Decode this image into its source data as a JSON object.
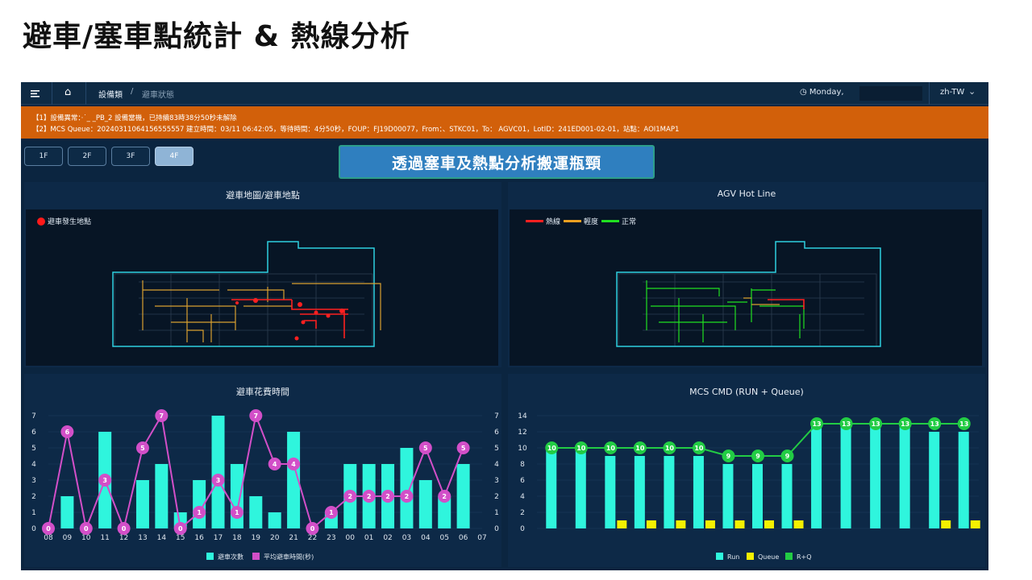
{
  "slide_title": "避車/塞車點統計 & 熱線分析",
  "topbar": {
    "breadcrumb_1": "設備類",
    "breadcrumb_sep": "/",
    "breadcrumb_2": "避車狀態",
    "clock": "Monday,",
    "language": "zh-TW"
  },
  "alerts": [
    "【1】設備異常：·˙_ _PB_2  設備當機，已持續83時38分50秒未解除",
    "【2】MCS Queue：20240311064156555557  建立時間：03/11 06:42:05，等待時間：4分50秒，FOUP：FJ19D00077，From：、STKC01，To：  AGVC01，LotID：241ED001-02-01，站點：AOI1MAP1"
  ],
  "floors": [
    "1F",
    "2F",
    "3F",
    "4F"
  ],
  "active_floor": "4F",
  "banner": "透過塞車及熱點分析搬運瓶頸",
  "map_panel": {
    "title": "避車地圖/避車地點",
    "legend": "避車發生地點"
  },
  "hotline_panel": {
    "title": "AGV Hot Line",
    "legend": [
      {
        "label": "熱線",
        "color": "#ff2020"
      },
      {
        "label": "輕度",
        "color": "#f0a020"
      },
      {
        "label": "正常",
        "color": "#20e020"
      }
    ]
  },
  "colors": {
    "accent": "#2f7fbf",
    "alert": "#d2600a",
    "bar_cyan": "#2ff5dd",
    "line_magenta": "#d24fc8",
    "queue_yellow": "#f5f000",
    "rq_green": "#22cc44"
  },
  "chart_data": [
    {
      "type": "bar",
      "title": "避車花費時間",
      "categories": [
        "08",
        "09",
        "10",
        "11",
        "12",
        "13",
        "14",
        "15",
        "16",
        "17",
        "18",
        "19",
        "20",
        "21",
        "22",
        "23",
        "00",
        "01",
        "02",
        "03",
        "04",
        "05",
        "06",
        "07"
      ],
      "ylim": [
        0,
        7
      ],
      "yticks": [
        0,
        1,
        2,
        3,
        4,
        5,
        6,
        7
      ],
      "series": [
        {
          "name": "避車次數",
          "kind": "bar",
          "values": [
            0,
            2,
            0,
            6,
            0,
            3,
            4,
            1,
            3,
            7,
            4,
            2,
            1,
            6,
            0,
            1,
            4,
            4,
            4,
            5,
            3,
            2,
            4,
            null
          ]
        },
        {
          "name": "平均避車時間(秒)",
          "kind": "line",
          "values": [
            0,
            6,
            0,
            3,
            0,
            5,
            7,
            0,
            1,
            3,
            1,
            7,
            4,
            4,
            0,
            1,
            2,
            2,
            2,
            2,
            5,
            2,
            5,
            null
          ]
        }
      ]
    },
    {
      "type": "bar",
      "title": "MCS CMD (RUN + Queue)",
      "categories": [
        "",
        "",
        "",
        "",
        "",
        "",
        "",
        "",
        "",
        "",
        "",
        "",
        "",
        "",
        ""
      ],
      "ylim": [
        0,
        14
      ],
      "yticks": [
        0,
        2,
        4,
        6,
        8,
        10,
        12,
        14
      ],
      "series": [
        {
          "name": "Run",
          "kind": "bar",
          "values": [
            10,
            10,
            9,
            9,
            9,
            9,
            8,
            8,
            8,
            13,
            13,
            13,
            13,
            12,
            12
          ]
        },
        {
          "name": "Queue",
          "kind": "bar",
          "values": [
            0,
            0,
            1,
            1,
            1,
            1,
            1,
            1,
            1,
            0,
            0,
            0,
            0,
            1,
            1
          ]
        },
        {
          "name": "R+Q",
          "kind": "line",
          "values": [
            10,
            10,
            10,
            10,
            10,
            10,
            9,
            9,
            9,
            13,
            13,
            13,
            13,
            13,
            13
          ]
        }
      ]
    }
  ]
}
